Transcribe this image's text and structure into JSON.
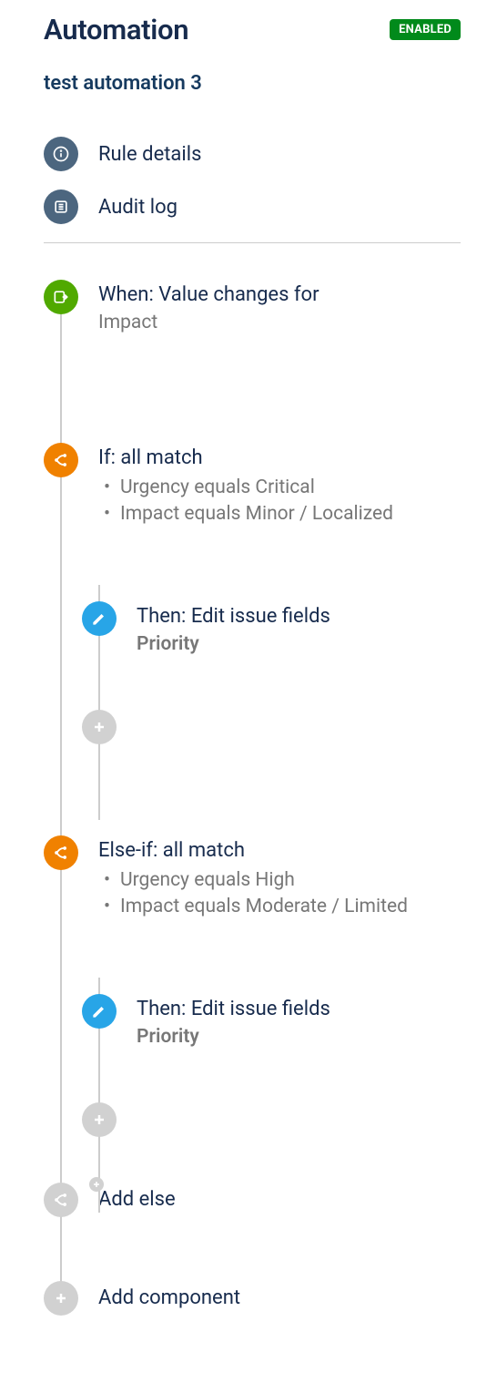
{
  "header": {
    "title": "Automation",
    "status": "ENABLED"
  },
  "rule_name": "test automation 3",
  "nav": {
    "rule_details": "Rule details",
    "audit_log": "Audit log"
  },
  "trigger": {
    "title": "When: Value changes for",
    "field": "Impact"
  },
  "branch1": {
    "title": "If: all match",
    "cond1": "Urgency equals Critical",
    "cond2": "Impact equals Minor / Localized",
    "action": {
      "title": "Then: Edit issue fields",
      "field": "Priority"
    }
  },
  "branch2": {
    "title": "Else-if: all match",
    "cond1": "Urgency equals High",
    "cond2": "Impact equals Moderate / Limited",
    "action": {
      "title": "Then: Edit issue fields",
      "field": "Priority"
    }
  },
  "add_else": "Add else",
  "add_component": "Add component"
}
